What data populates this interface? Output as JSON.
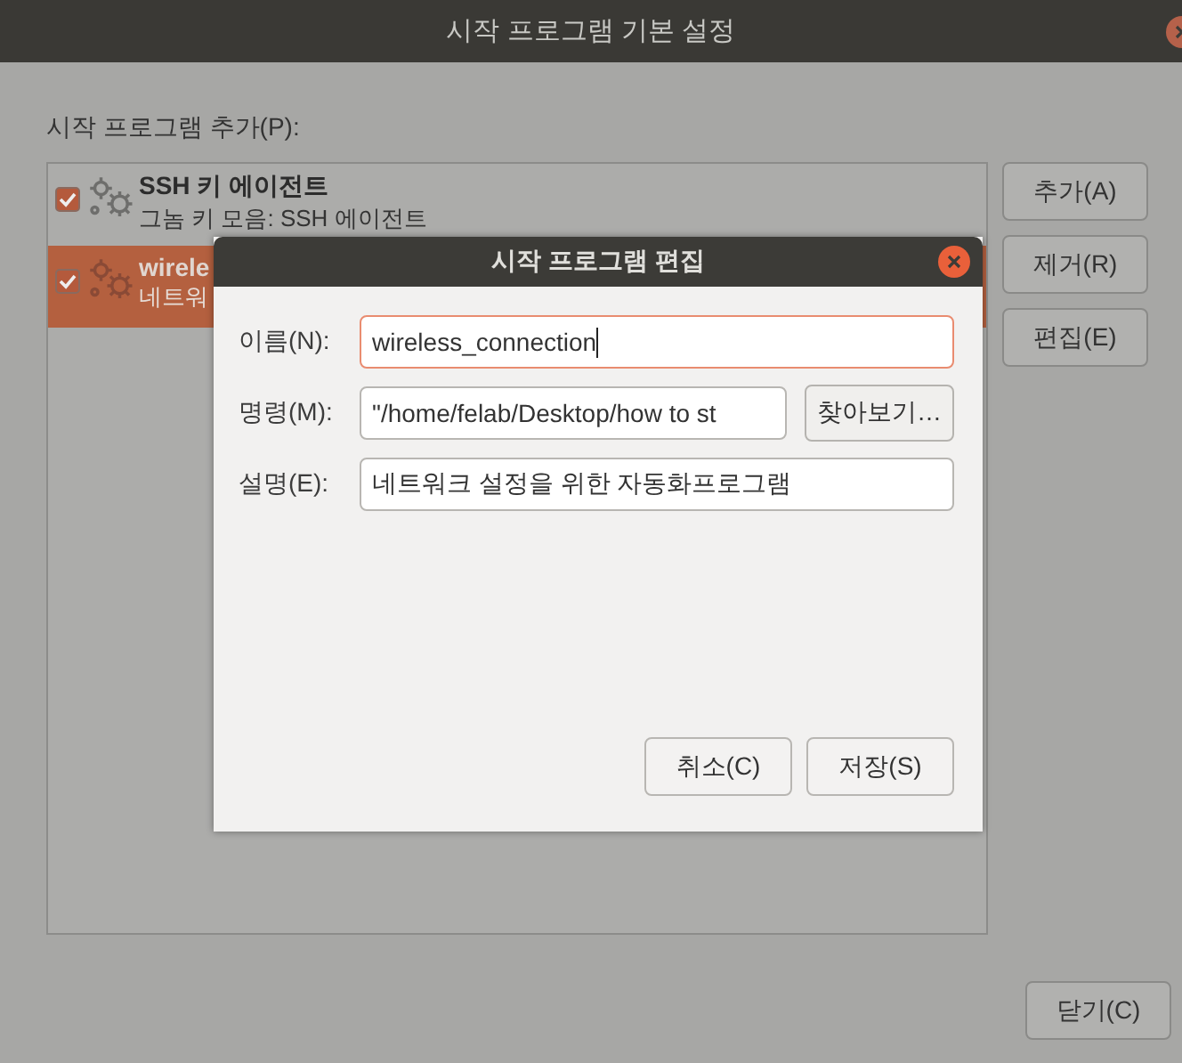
{
  "window": {
    "title": "시작 프로그램 기본 설정"
  },
  "list_label": "시작 프로그램 추가(P):",
  "programs": [
    {
      "name": "SSH 키 에이전트",
      "description": "그놈 키 모음: SSH 에이전트",
      "checked": true,
      "selected": false
    },
    {
      "name": "wirele",
      "description": "네트워",
      "checked": true,
      "selected": true
    }
  ],
  "side_buttons": [
    "추가(A)",
    "제거(R)",
    "편집(E)"
  ],
  "close_button": "닫기(C)",
  "dialog": {
    "title": "시작 프로그램 편집",
    "fields": [
      {
        "label": "이름(N):",
        "value": "wireless_connection",
        "focused": true
      },
      {
        "label": "명령(M):",
        "value": "\"/home/felab/Desktop/how to st",
        "focused": false,
        "browse": "찾아보기…"
      },
      {
        "label": "설명(E):",
        "value": "네트워크 설정을 위한 자동화프로그램",
        "focused": false
      }
    ],
    "buttons": [
      "취소(C)",
      "저장(S)"
    ]
  }
}
